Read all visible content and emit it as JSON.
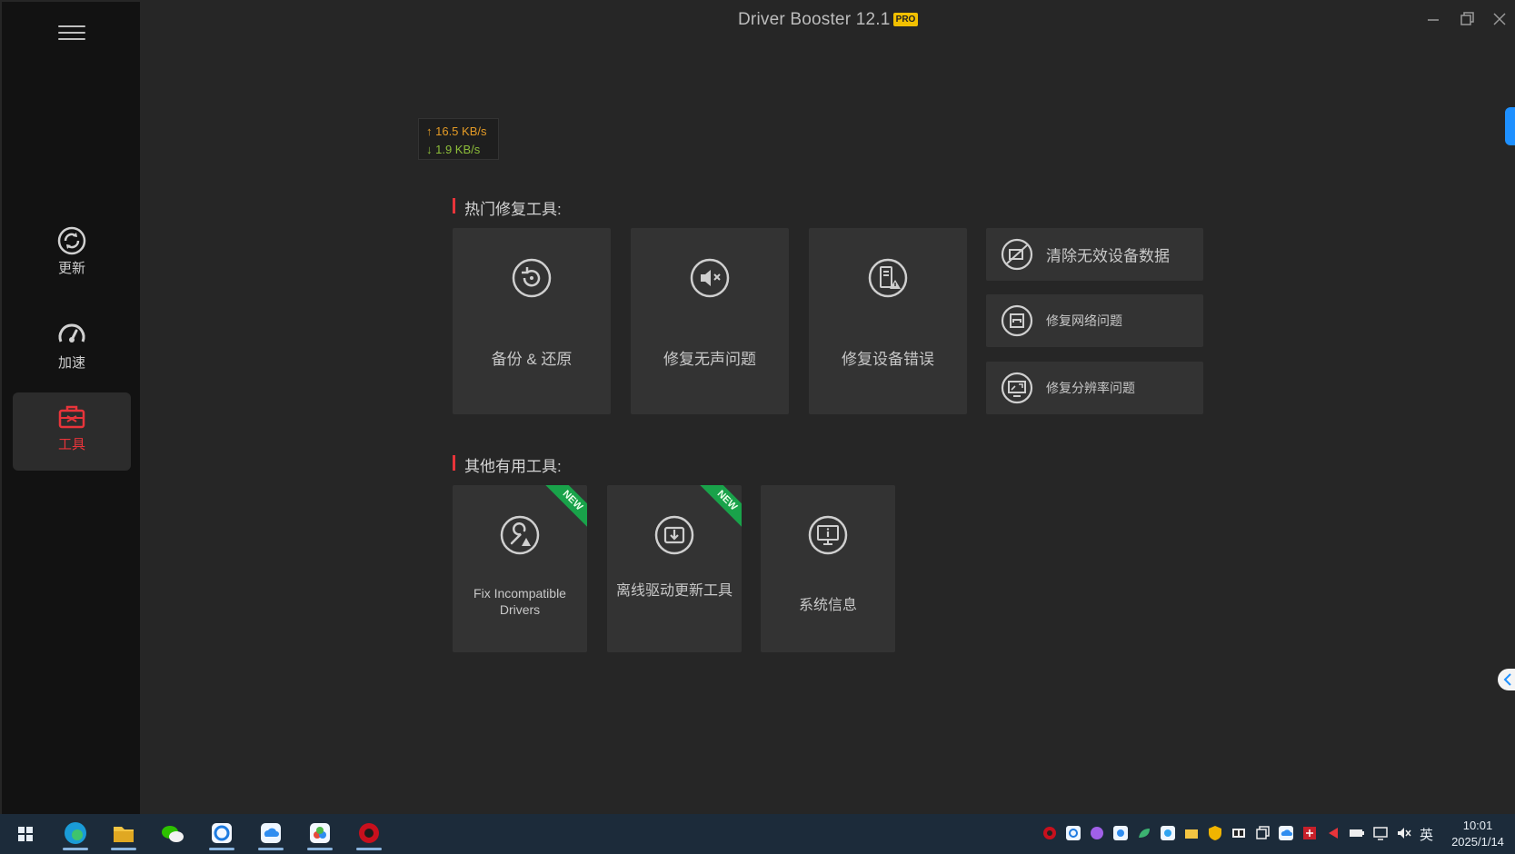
{
  "app": {
    "title": "Driver Booster 12.1",
    "badge": "PRO",
    "accent": "#e8343a"
  },
  "sidebar": {
    "items": [
      {
        "label": "更新",
        "icon": "refresh-icon",
        "active": false
      },
      {
        "label": "加速",
        "icon": "speedometer-icon",
        "active": false
      },
      {
        "label": "工具",
        "icon": "toolbox-icon",
        "active": true
      }
    ]
  },
  "speed": {
    "up": "↑ 16.5 KB/s",
    "down": "↓ 1.9 KB/s"
  },
  "hot_tools": {
    "title": "热门修复工具:",
    "big": [
      {
        "label": "备份 & 还原",
        "icon": "backup-restore-icon"
      },
      {
        "label": "修复无声问题",
        "icon": "speaker-mute-icon"
      },
      {
        "label": "修复设备错误",
        "icon": "device-warning-icon"
      }
    ],
    "wide": [
      {
        "label": "清除无效设备数据",
        "icon": "clear-device-data-icon"
      },
      {
        "label": "修复网络问题",
        "icon": "network-icon"
      },
      {
        "label": "修复分辨率问题",
        "icon": "resolution-icon"
      }
    ]
  },
  "other_tools": {
    "title": "其他有用工具:",
    "items": [
      {
        "label": "Fix Incompatible Drivers",
        "icon": "wrench-warning-icon",
        "badge": "NEW"
      },
      {
        "label": "离线驱动更新工具",
        "icon": "offline-update-icon",
        "badge": "NEW"
      },
      {
        "label": "系统信息",
        "icon": "system-info-icon",
        "badge": ""
      }
    ]
  },
  "taskbar": {
    "apps": [
      "windows-start-icon",
      "edge-icon",
      "file-explorer-icon",
      "wechat-icon",
      "app-icon",
      "cloud-icon",
      "baidu-netdisk-icon",
      "driver-booster-icon"
    ],
    "ime": "英",
    "time": "10:01",
    "date": "2025/1/14"
  }
}
